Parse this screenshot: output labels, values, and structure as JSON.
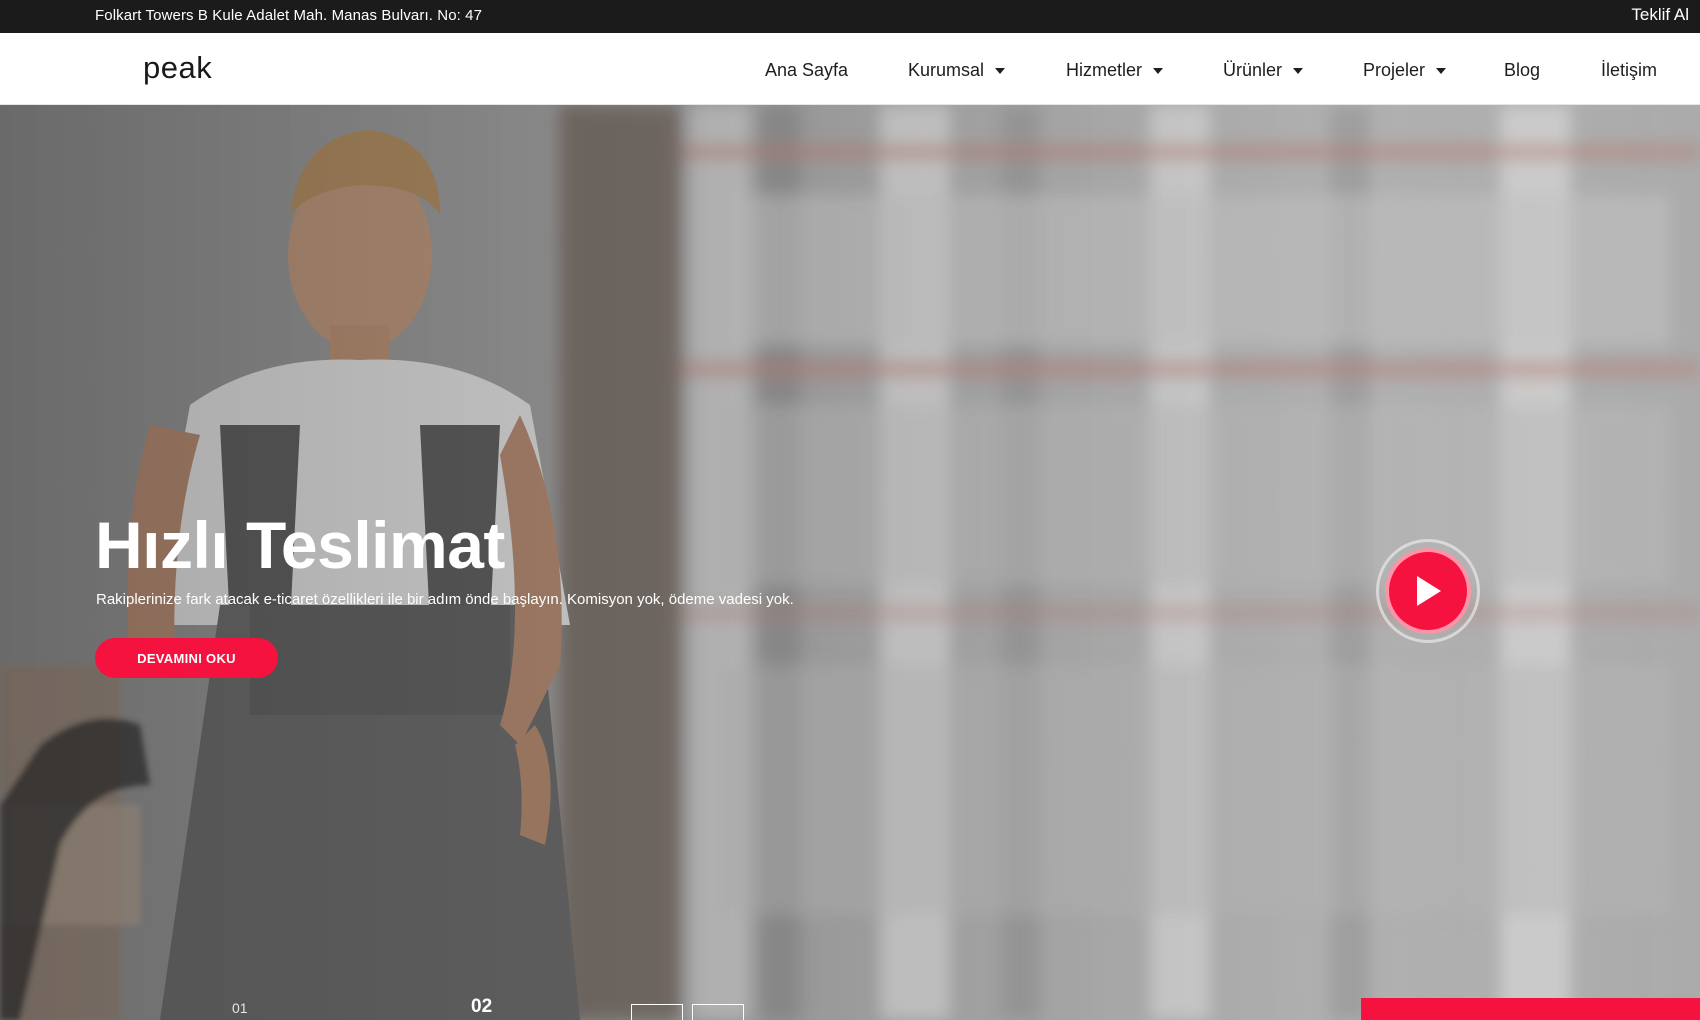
{
  "topbar": {
    "address": "Folkart Towers B Kule Adalet Mah. Manas Bulvarı. No: 47",
    "quote_link": "Teklif Al"
  },
  "header": {
    "logo": "peak",
    "nav": [
      {
        "label": "Ana Sayfa",
        "has_dropdown": false
      },
      {
        "label": "Kurumsal",
        "has_dropdown": true
      },
      {
        "label": "Hizmetler",
        "has_dropdown": true
      },
      {
        "label": "Ürünler",
        "has_dropdown": true
      },
      {
        "label": "Projeler",
        "has_dropdown": true
      },
      {
        "label": "Blog",
        "has_dropdown": false
      },
      {
        "label": "İletişim",
        "has_dropdown": false
      }
    ]
  },
  "hero": {
    "title": "Hızlı Teslimat",
    "subtitle": "Rakiplerinize fark atacak e-ticaret özellikleri ile bir adım önde başlayın. Komisyon yok, ödeme vadesi yok.",
    "cta_label": "DEVAMINI OKU",
    "play_icon": "play-icon",
    "slides": [
      "01",
      "02"
    ],
    "active_slide": "02"
  },
  "colors": {
    "accent": "#f5123e",
    "topbar_bg": "#1b1b1c",
    "header_bg": "#ffffff",
    "nav_text": "#1e1e1e"
  }
}
